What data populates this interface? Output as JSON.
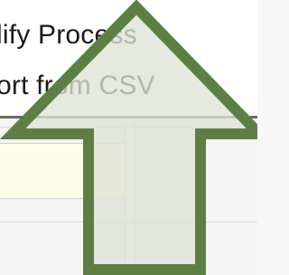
{
  "menu": {
    "items": [
      {
        "label": ""
      },
      {
        "label": "lify Process"
      },
      {
        "label": "ort from CSV"
      }
    ]
  },
  "overlay": {
    "icon": "up-arrow-icon",
    "fill": "#dfe3d6",
    "stroke": "#5d7f44"
  }
}
